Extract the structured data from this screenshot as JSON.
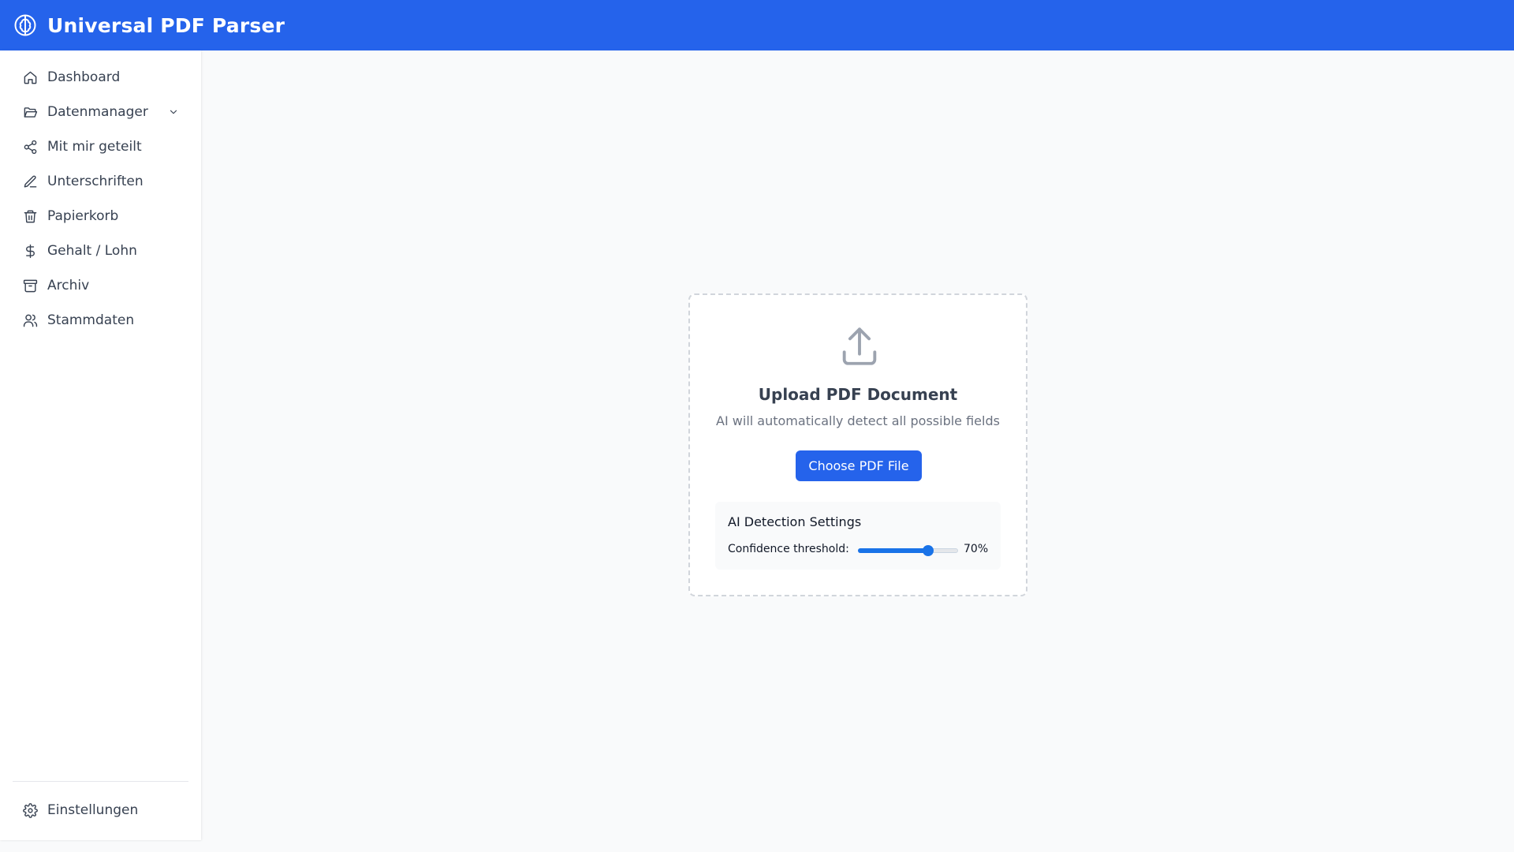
{
  "app": {
    "title": "Universal PDF Parser",
    "accent_color": "#2563eb"
  },
  "sidebar": {
    "items": [
      {
        "label": "Dashboard",
        "icon": "home-icon"
      },
      {
        "label": "Datenmanager",
        "icon": "folder-open-icon",
        "expandable": true
      },
      {
        "label": "Mit mir geteilt",
        "icon": "share-icon"
      },
      {
        "label": "Unterschriften",
        "icon": "pen-icon"
      },
      {
        "label": "Papierkorb",
        "icon": "trash-icon"
      },
      {
        "label": "Gehalt / Lohn",
        "icon": "dollar-icon"
      },
      {
        "label": "Archiv",
        "icon": "archive-icon"
      },
      {
        "label": "Stammdaten",
        "icon": "users-icon"
      }
    ],
    "settings": {
      "label": "Einstellungen",
      "icon": "gear-icon"
    }
  },
  "upload": {
    "icon": "upload-icon",
    "title": "Upload PDF Document",
    "subtitle": "AI will automatically detect all possible fields",
    "button_label": "Choose PDF File",
    "settings": {
      "title": "AI Detection Settings",
      "threshold_label": "Confidence threshold:",
      "threshold_value": 70,
      "threshold_text": "70%"
    }
  }
}
